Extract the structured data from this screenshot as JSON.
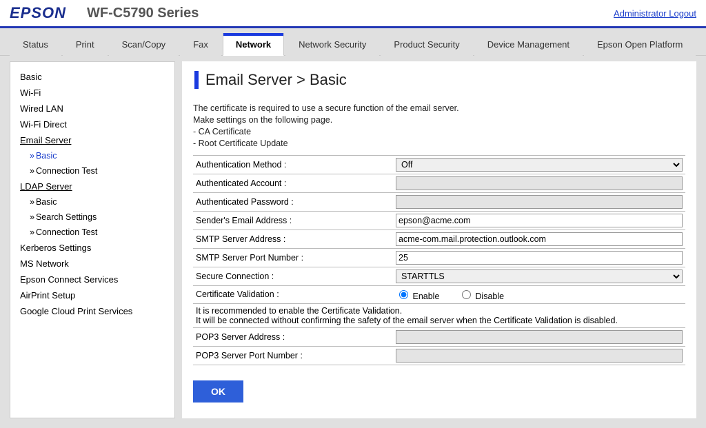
{
  "header": {
    "brand": "EPSON",
    "model": "WF-C5790 Series",
    "logout": "Administrator Logout"
  },
  "tabs": [
    "Status",
    "Print",
    "Scan/Copy",
    "Fax",
    "Network",
    "Network Security",
    "Product Security",
    "Device Management",
    "Epson Open Platform"
  ],
  "active_tab": "Network",
  "sidebar": {
    "items": [
      {
        "label": "Basic",
        "type": "item"
      },
      {
        "label": "Wi-Fi",
        "type": "item"
      },
      {
        "label": "Wired LAN",
        "type": "item"
      },
      {
        "label": "Wi-Fi Direct",
        "type": "item"
      },
      {
        "label": "Email Server",
        "type": "section"
      },
      {
        "label": "Basic",
        "type": "sub",
        "active": true
      },
      {
        "label": "Connection Test",
        "type": "sub"
      },
      {
        "label": "LDAP Server",
        "type": "section"
      },
      {
        "label": "Basic",
        "type": "sub"
      },
      {
        "label": "Search Settings",
        "type": "sub"
      },
      {
        "label": "Connection Test",
        "type": "sub"
      },
      {
        "label": "Kerberos Settings",
        "type": "item"
      },
      {
        "label": "MS Network",
        "type": "item"
      },
      {
        "label": "Epson Connect Services",
        "type": "item"
      },
      {
        "label": "AirPrint Setup",
        "type": "item"
      },
      {
        "label": "Google Cloud Print Services",
        "type": "item"
      }
    ]
  },
  "page": {
    "title": "Email Server > Basic",
    "info_lines": [
      "The certificate is required to use a secure function of the email server.",
      "Make settings on the following page.",
      "- CA Certificate",
      "- Root Certificate Update"
    ],
    "cert_note1": "It is recommended to enable the Certificate Validation.",
    "cert_note2": "It will be connected without confirming the safety of the email server when the Certificate Validation is disabled.",
    "ok": "OK"
  },
  "form": {
    "auth_method_label": "Authentication Method :",
    "auth_method_value": "Off",
    "auth_account_label": "Authenticated Account :",
    "auth_account_value": "",
    "auth_password_label": "Authenticated Password :",
    "auth_password_value": "",
    "sender_label": "Sender's Email Address :",
    "sender_value": "epson@acme.com",
    "smtp_addr_label": "SMTP Server Address :",
    "smtp_addr_value": "acme-com.mail.protection.outlook.com",
    "smtp_port_label": "SMTP Server Port Number :",
    "smtp_port_value": "25",
    "secure_conn_label": "Secure Connection :",
    "secure_conn_value": "STARTTLS",
    "cert_val_label": "Certificate Validation :",
    "cert_val_enable": "Enable",
    "cert_val_disable": "Disable",
    "cert_val_selected": "enable",
    "pop3_addr_label": "POP3 Server Address :",
    "pop3_addr_value": "",
    "pop3_port_label": "POP3 Server Port Number :",
    "pop3_port_value": ""
  }
}
